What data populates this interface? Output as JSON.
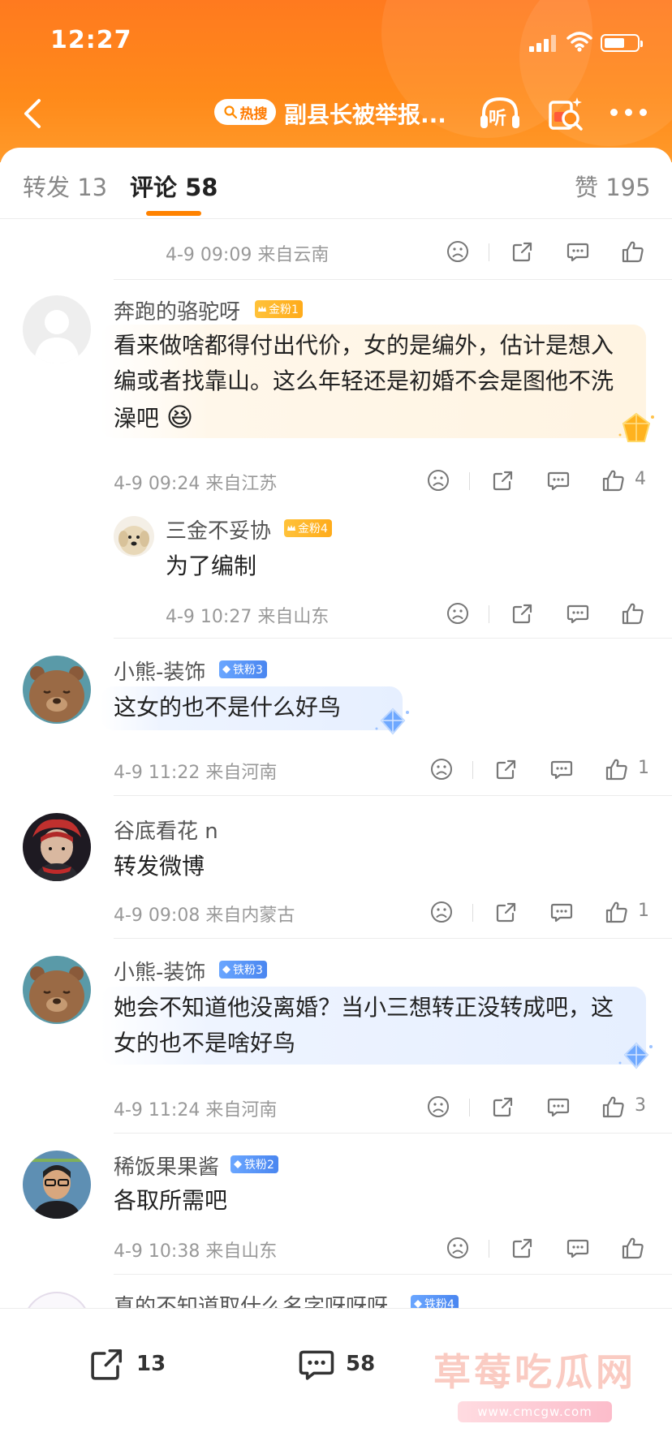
{
  "status": {
    "time": "12:27"
  },
  "nav": {
    "hot_label": "热搜",
    "title": "副县长被举报...",
    "listen_label": "听"
  },
  "tabs": [
    {
      "label": "转发",
      "count": "13"
    },
    {
      "label": "评论",
      "count": "58"
    },
    {
      "label": "赞",
      "count": "195"
    }
  ],
  "comments": [
    {
      "meta": "4-9 09:09 来自云南",
      "likes": ""
    },
    {
      "user": "奔跑的骆驼呀",
      "fan_badge": "金粉1",
      "text": "看来做啥都得付出代价，女的是编外，估计是想入编或者找靠山。这么年轻还是初婚不会是图他不洗澡吧",
      "emoji": "😆",
      "meta": "4-9 09:24 来自江苏",
      "likes": "4"
    },
    {
      "user": "三金不妥协",
      "fan_badge": "金粉4",
      "text": "为了编制",
      "meta": "4-9 10:27 来自山东",
      "likes": ""
    },
    {
      "user": "小熊-装饰",
      "fan_badge": "铁粉3",
      "text": "这女的也不是什么好鸟",
      "meta": "4-9 11:22 来自河南",
      "likes": "1"
    },
    {
      "user": "谷底看花 n",
      "fan_badge": "",
      "text": "转发微博",
      "meta": "4-9 09:08 来自内蒙古",
      "likes": "1"
    },
    {
      "user": "小熊-装饰",
      "fan_badge": "铁粉3",
      "text": "她会不知道他没离婚？当小三想转正没转成吧，这女的也不是啥好鸟",
      "meta": "4-9 11:24 来自河南",
      "likes": "3"
    },
    {
      "user": "稀饭果果酱",
      "fan_badge": "铁粉2",
      "text": "各取所需吧",
      "meta": "4-9 10:38 来自山东",
      "likes": ""
    },
    {
      "user": "真的不知道取什么名字呀呀呀",
      "fan_badge": "铁粉4"
    }
  ],
  "bottom": {
    "repost_count": "13",
    "comment_count": "58"
  },
  "watermark": {
    "main": "草莓吃瓜网",
    "sub": "www.cmcgw.com"
  },
  "colors": {
    "header": "#ff7a1f",
    "accent": "#ff8200",
    "gold_badge": "#ffb21f",
    "iron_badge": "#4a86f0"
  }
}
